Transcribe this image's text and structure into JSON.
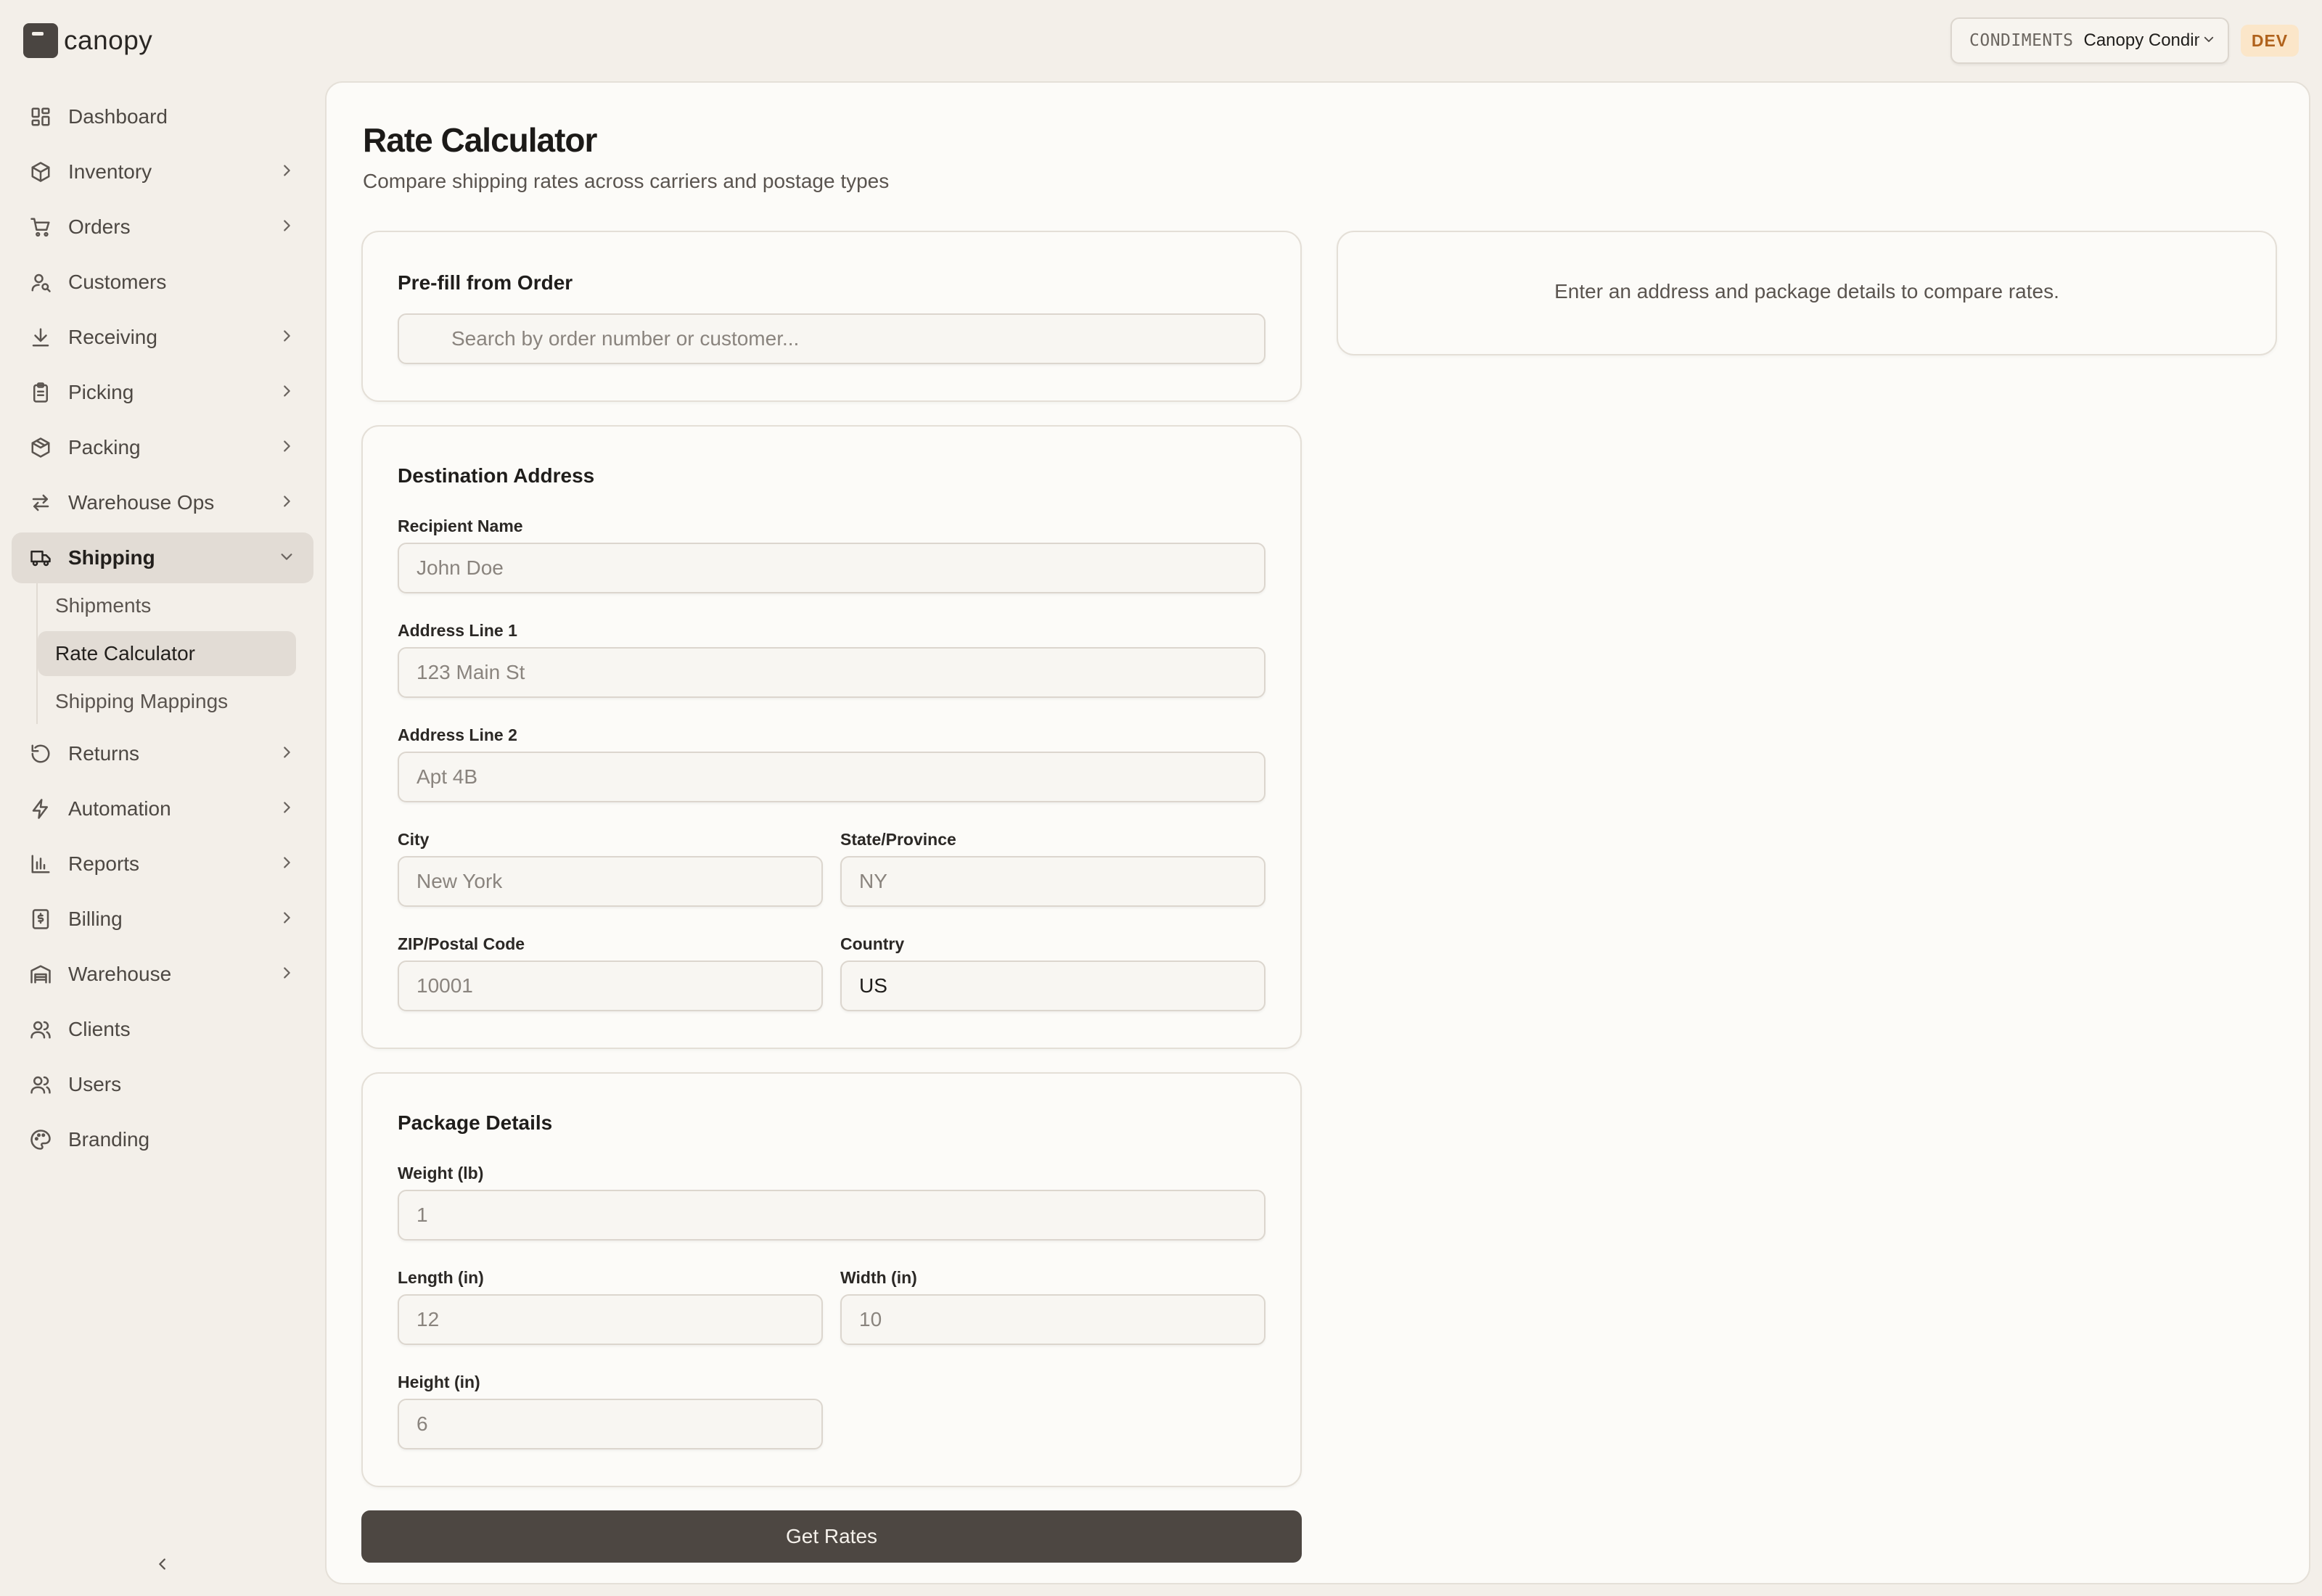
{
  "app": {
    "name": "canopy"
  },
  "sidebar": {
    "items": [
      {
        "label": "Dashboard",
        "icon": "dashboard-icon"
      },
      {
        "label": "Inventory",
        "icon": "box-icon"
      },
      {
        "label": "Orders",
        "icon": "cart-icon"
      },
      {
        "label": "Customers",
        "icon": "customers-icon"
      },
      {
        "label": "Receiving",
        "icon": "download-icon"
      },
      {
        "label": "Picking",
        "icon": "clipboard-icon"
      },
      {
        "label": "Packing",
        "icon": "package-icon"
      },
      {
        "label": "Warehouse Ops",
        "icon": "swap-icon"
      },
      {
        "label": "Shipping",
        "icon": "truck-icon"
      },
      {
        "label": "Returns",
        "icon": "rotate-icon"
      },
      {
        "label": "Automation",
        "icon": "bolt-icon"
      },
      {
        "label": "Reports",
        "icon": "bar-chart-icon"
      },
      {
        "label": "Billing",
        "icon": "receipt-icon"
      },
      {
        "label": "Warehouse",
        "icon": "warehouse-icon"
      },
      {
        "label": "Clients",
        "icon": "users-icon"
      },
      {
        "label": "Users",
        "icon": "users-icon"
      },
      {
        "label": "Branding",
        "icon": "palette-icon"
      }
    ],
    "shipping_sub": [
      {
        "label": "Shipments"
      },
      {
        "label": "Rate Calculator"
      },
      {
        "label": "Shipping Mappings"
      }
    ]
  },
  "header": {
    "tenant_code": "CONDIMENTS",
    "tenant_name": "Canopy Condiments",
    "env": "DEV"
  },
  "page": {
    "title": "Rate Calculator",
    "subtitle": "Compare shipping rates across carriers and postage types"
  },
  "prefill": {
    "title": "Pre-fill from Order",
    "search_placeholder": "Search by order number or customer..."
  },
  "destination": {
    "title": "Destination Address",
    "recipient": {
      "label": "Recipient Name",
      "placeholder": "John Doe"
    },
    "address1": {
      "label": "Address Line 1",
      "placeholder": "123 Main St"
    },
    "address2": {
      "label": "Address Line 2",
      "placeholder": "Apt 4B"
    },
    "city": {
      "label": "City",
      "placeholder": "New York"
    },
    "state": {
      "label": "State/Province",
      "placeholder": "NY"
    },
    "zip": {
      "label": "ZIP/Postal Code",
      "placeholder": "10001"
    },
    "country": {
      "label": "Country",
      "value": "US"
    }
  },
  "package": {
    "title": "Package Details",
    "weight": {
      "label": "Weight (lb)",
      "placeholder": "1"
    },
    "length": {
      "label": "Length (in)",
      "placeholder": "12"
    },
    "width": {
      "label": "Width (in)",
      "placeholder": "10"
    },
    "height": {
      "label": "Height (in)",
      "placeholder": "6"
    }
  },
  "results": {
    "empty_message": "Enter an address and package details to compare rates."
  },
  "actions": {
    "get_rates": "Get Rates"
  },
  "colors": {
    "primary_button": "#4d4742",
    "env_badge_bg": "#fbe6c9",
    "env_badge_text": "#b0621c"
  }
}
